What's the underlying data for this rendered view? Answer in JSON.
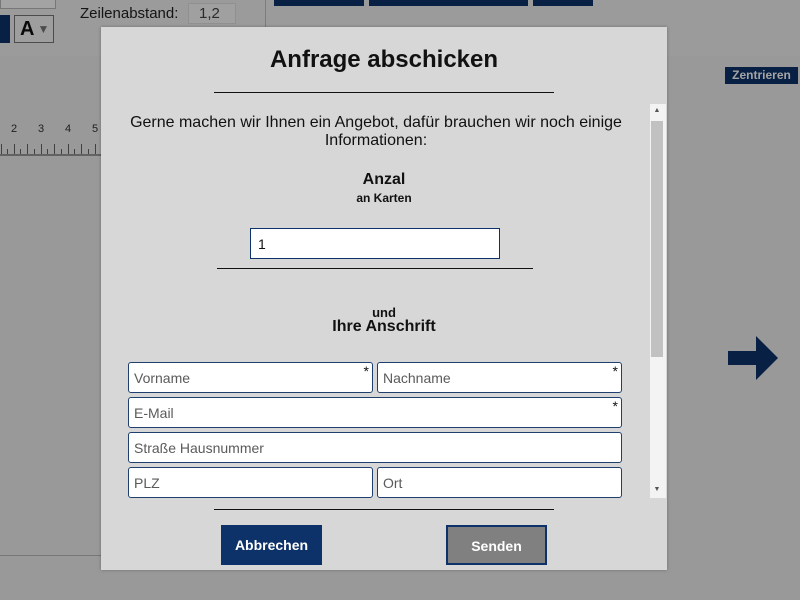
{
  "background": {
    "toolbar": {
      "line_spacing_label": "Zeilenabstand:",
      "line_spacing_value": "1,2",
      "font_button_label": "A"
    },
    "center_button": "Zentrieren",
    "ruler_numbers": [
      "2",
      "3",
      "4",
      "5"
    ],
    "next_icon": "arrow-right-icon",
    "accent_color": "#0d3269"
  },
  "modal": {
    "title": "Anfrage abschicken",
    "intro": "Gerne machen wir Ihnen ein Angebot, dafür brauchen wir noch einige Informationen:",
    "quantity": {
      "title": "Anzal",
      "subtitle": "an Karten",
      "value": "1"
    },
    "address": {
      "pretitle": "und",
      "title": "Ihre Anschrift",
      "required_mark": "*",
      "fields": {
        "first_name": {
          "placeholder": "Vorname",
          "required": true
        },
        "last_name": {
          "placeholder": "Nachname",
          "required": true
        },
        "email": {
          "placeholder": "E-Mail",
          "required": true
        },
        "street": {
          "placeholder": "Straße Hausnummer",
          "required": false
        },
        "zip": {
          "placeholder": "PLZ",
          "required": false
        },
        "city": {
          "placeholder": "Ort",
          "required": false
        }
      }
    },
    "buttons": {
      "cancel": "Abbrechen",
      "send": "Senden"
    }
  }
}
